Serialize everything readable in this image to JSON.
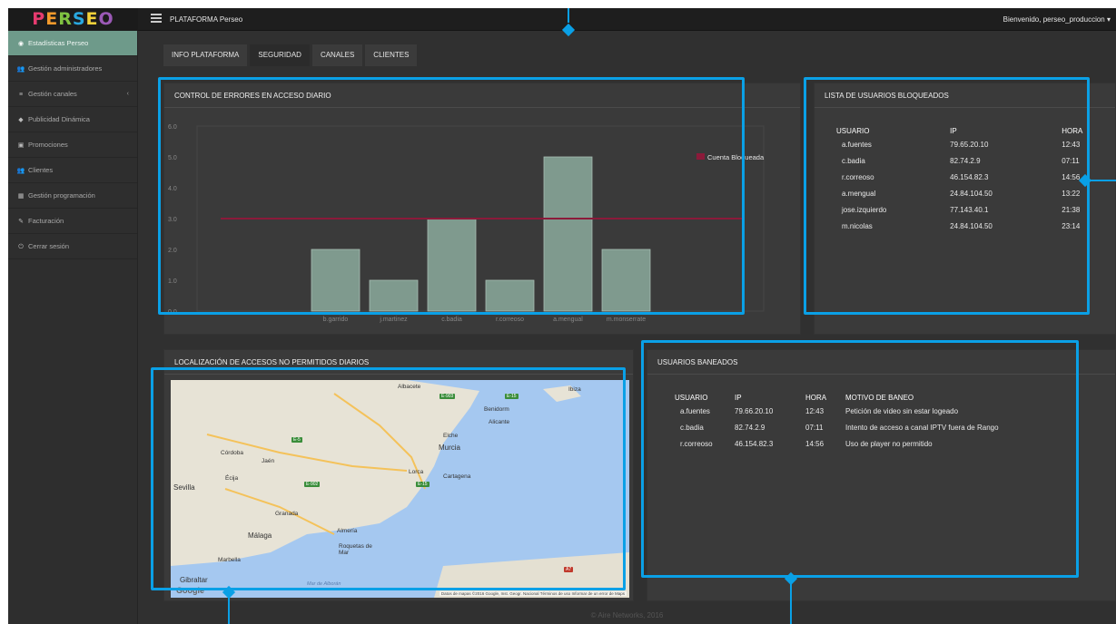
{
  "app": {
    "logo": "PERSEO",
    "title": "PLATAFORMA Perseo",
    "welcome": "Bienvenido, perseo_produccion ▾",
    "footer": "© Aire Networks, 2016"
  },
  "colors": {
    "accent": "#0aa0e6",
    "sidebar_active": "#6e9a8a",
    "bar_fill": "#7f9a8e",
    "limit_line": "#8b1a3a"
  },
  "sidebar": {
    "items": [
      {
        "label": "Estadísticas Perseo",
        "icon": "dashboard-icon",
        "glyph": "◉"
      },
      {
        "label": "Gestión administradores",
        "icon": "users-icon",
        "glyph": "👥"
      },
      {
        "label": "Gestión canales",
        "icon": "list-icon",
        "glyph": "≡"
      },
      {
        "label": "Publicidad Dinámica",
        "icon": "tag-icon",
        "glyph": "◆"
      },
      {
        "label": "Promociones",
        "icon": "gift-icon",
        "glyph": "▣"
      },
      {
        "label": "Clientes",
        "icon": "clients-icon",
        "glyph": "👥"
      },
      {
        "label": "Gestión programación",
        "icon": "calendar-icon",
        "glyph": "▦"
      },
      {
        "label": "Facturación",
        "icon": "pen-icon",
        "glyph": "✎"
      },
      {
        "label": "Cerrar sesión",
        "icon": "power-icon",
        "glyph": "⏻"
      }
    ],
    "collapse_caret": "‹"
  },
  "tabs": [
    "INFO PLATAFORMA",
    "SEGURIDAD",
    "CANALES",
    "CLIENTES"
  ],
  "errors_panel": {
    "title": "CONTROL DE ERRORES EN ACCESO DIARIO"
  },
  "chart_data": {
    "type": "bar",
    "categories": [
      "b.garrido",
      "j.martinez",
      "c.badia",
      "r.correoso",
      "a.mengual",
      "m.monserrate"
    ],
    "values": [
      2,
      1,
      3,
      1,
      5,
      2
    ],
    "yticks": [
      "0.0",
      "1.0",
      "2.0",
      "3.0",
      "4.0",
      "5.0",
      "6.0"
    ],
    "ylim": [
      0,
      6
    ],
    "limit_line": {
      "value": 3,
      "name": "Cuenta Bloqueada"
    },
    "legend_position": "top-right",
    "grid": false
  },
  "blocked_panel": {
    "title": "LISTA DE USUARIOS BLOQUEADOS",
    "headers": [
      "USUARIO",
      "IP",
      "HORA"
    ],
    "rows": [
      [
        "a.fuentes",
        "79.65.20.10",
        "12:43"
      ],
      [
        "c.badia",
        "82.74.2.9",
        "07:11"
      ],
      [
        "r.correoso",
        "46.154.82.3",
        "14:56"
      ],
      [
        "a.mengual",
        "24.84.104.50",
        "13:22"
      ],
      [
        "jose.izquierdo",
        "77.143.40.1",
        "21:38"
      ],
      [
        "m.nicolas",
        "24.84.104.50",
        "23:14"
      ]
    ]
  },
  "map_panel": {
    "title": "LOCALIZACIÓN DE ACCESOS NO PERMITIDOS DIARIOS",
    "places": [
      "Albacete",
      "Benidorm",
      "Alicante",
      "Elche",
      "Murcia",
      "Lorca",
      "Cartagena",
      "Córdoba",
      "Jaén",
      "Écija",
      "Sevilla",
      "Granada",
      "Almería",
      "Málaga",
      "Roquetas de Mar",
      "Marbella",
      "Gibraltar",
      "Ibiza"
    ],
    "sea_label": "Mar de Alborán",
    "attribution": "Datos de mapas ©2016 Google, Inst. Geogr. Nacional   Términos de uso   Informar de un error de Maps",
    "google": "Google",
    "roads": [
      "E-903",
      "E-15",
      "E-5",
      "E-902",
      "E-15",
      "A7"
    ]
  },
  "banned_panel": {
    "title": "USUARIOS BANEADOS",
    "headers": [
      "USUARIO",
      "IP",
      "HORA",
      "MOTIVO DE BANEO"
    ],
    "rows": [
      [
        "a.fuentes",
        "79.66.20.10",
        "12:43",
        "Petición de video sin estar logeado"
      ],
      [
        "c.badia",
        "82.74.2.9",
        "07:11",
        "Intento de acceso a canal IPTV fuera de Rango"
      ],
      [
        "r.correoso",
        "46.154.82.3",
        "14:56",
        "Uso de player no permitido"
      ]
    ]
  }
}
